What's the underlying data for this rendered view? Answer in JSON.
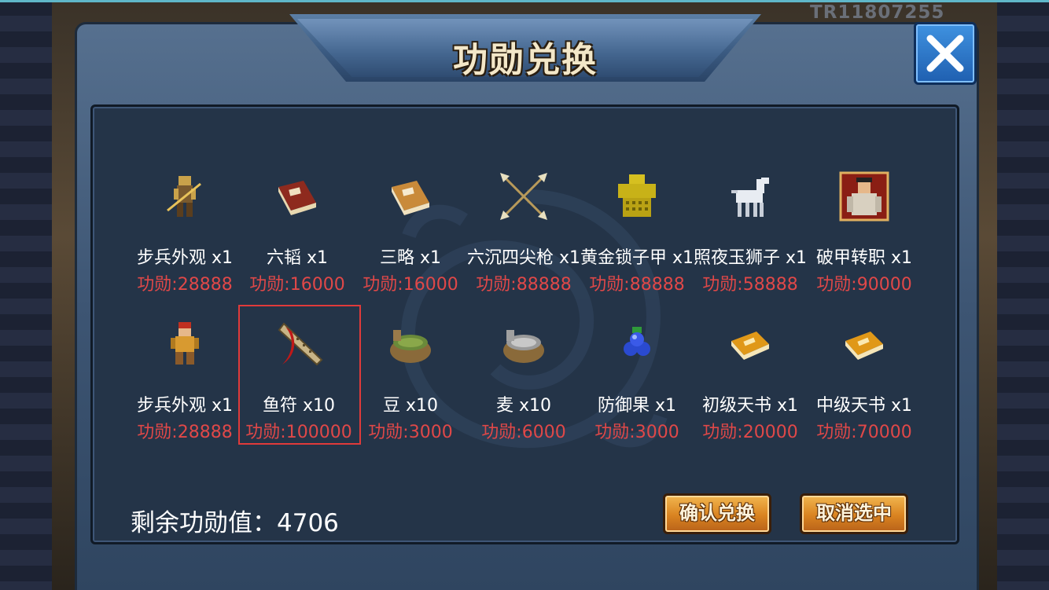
{
  "server_code": "TR11807255",
  "title": "功勋兑换",
  "items": [
    {
      "name": "步兵外观 x1",
      "cost": "功勋:28888",
      "icon": "infantry-skin-icon"
    },
    {
      "name": "六韬 x1",
      "cost": "功勋:16000",
      "icon": "red-book-icon"
    },
    {
      "name": "三略 x1",
      "cost": "功勋:16000",
      "icon": "tan-book-icon"
    },
    {
      "name": "六沉四尖枪 x1",
      "cost": "功勋:88888",
      "icon": "crossed-spears-icon"
    },
    {
      "name": "黄金锁子甲 x1",
      "cost": "功勋:88888",
      "icon": "gold-armor-icon"
    },
    {
      "name": "照夜玉狮子 x1",
      "cost": "功勋:58888",
      "icon": "white-horse-icon"
    },
    {
      "name": "破甲转职 x1",
      "cost": "功勋:90000",
      "icon": "class-change-portrait-icon"
    },
    {
      "name": "步兵外观 x1",
      "cost": "功勋:28888",
      "icon": "infantry-skin-icon"
    },
    {
      "name": "鱼符 x10",
      "cost": "功勋:100000",
      "icon": "fish-token-icon"
    },
    {
      "name": "豆 x10",
      "cost": "功勋:3000",
      "icon": "bean-sack-icon"
    },
    {
      "name": "麦 x10",
      "cost": "功勋:6000",
      "icon": "wheat-sack-icon"
    },
    {
      "name": "防御果 x1",
      "cost": "功勋:3000",
      "icon": "defense-fruit-icon"
    },
    {
      "name": "初级天书 x1",
      "cost": "功勋:20000",
      "icon": "orange-book-icon"
    },
    {
      "name": "中级天书 x1",
      "cost": "功勋:70000",
      "icon": "orange-book-icon"
    }
  ],
  "selected_index": 8,
  "remaining_label": "剩余功勋值：4706",
  "confirm_label": "确认兑换",
  "cancel_label": "取消选中"
}
